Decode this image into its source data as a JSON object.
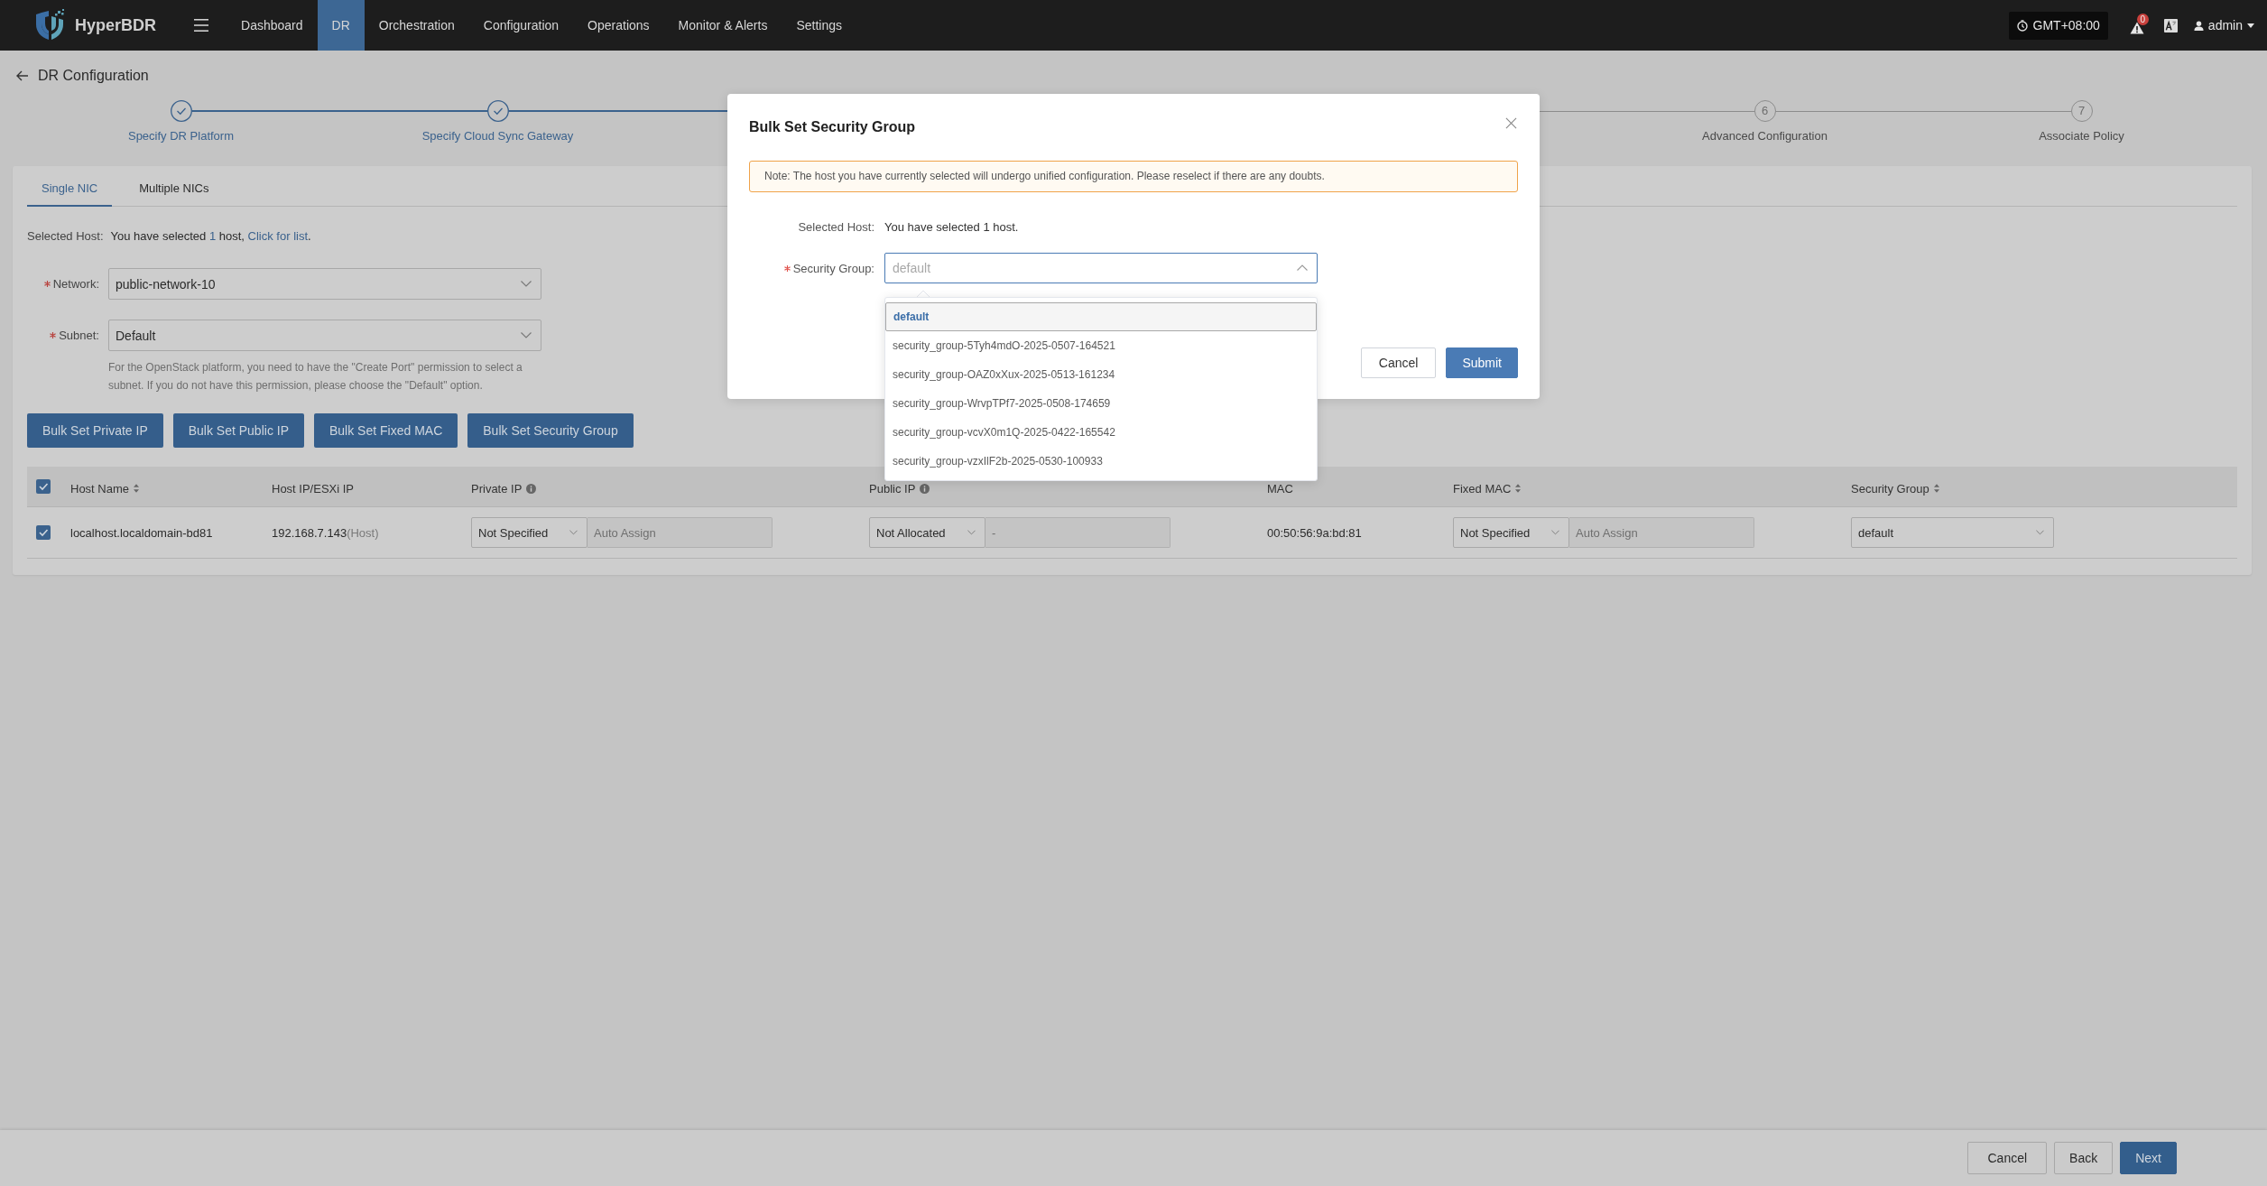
{
  "header": {
    "logo": "HyperBDR",
    "nav": [
      {
        "label": "Dashboard",
        "selected": false
      },
      {
        "label": "DR",
        "selected": true
      },
      {
        "label": "Orchestration",
        "selected": false
      },
      {
        "label": "Configuration",
        "selected": false
      },
      {
        "label": "Operations",
        "selected": false
      },
      {
        "label": "Monitor & Alerts",
        "selected": false
      },
      {
        "label": "Settings",
        "selected": false
      }
    ],
    "timezone": "GMT+08:00",
    "notification_count": "0",
    "user": "admin"
  },
  "page": {
    "title": "DR Configuration"
  },
  "stepper": {
    "steps": [
      {
        "label": "Specify DR Platform",
        "done": true
      },
      {
        "label": "Specify Cloud Sync Gateway",
        "done": true
      },
      {
        "label": "Advanced Configuration",
        "done": false,
        "number": "6"
      },
      {
        "label": "Associate Policy",
        "done": false,
        "number": "7"
      }
    ]
  },
  "card": {
    "tabs": [
      {
        "label": "Single NIC",
        "selected": true
      },
      {
        "label": "Multiple NICs",
        "selected": false
      }
    ],
    "selected_host": {
      "label": "Selected Host:",
      "text_start": "You have selected",
      "count": "1",
      "text_mid": "host,",
      "link": "Click for list",
      "text_end": "."
    },
    "fields": [
      {
        "label": "Network:",
        "required": true,
        "value": "public-network-10"
      },
      {
        "label": "Subnet:",
        "required": true,
        "value": "Default",
        "help": "For the OpenStack platform, you need to have the \"Create Port\" permission to select a subnet. If you do not have this permission, please choose the \"Default\" option."
      }
    ],
    "buttons": [
      "Bulk Set Private IP",
      "Bulk Set Public IP",
      "Bulk Set Fixed MAC",
      "Bulk Set Security Group"
    ],
    "table": {
      "select_all_checked": true,
      "columns": [
        {
          "label": "Host Name",
          "sortable": true,
          "info": false
        },
        {
          "label": "Host IP/ESXi IP",
          "sortable": false,
          "info": false
        },
        {
          "label": "Private IP",
          "sortable": false,
          "info": true
        },
        {
          "label": "Public IP",
          "sortable": false,
          "info": true
        },
        {
          "label": "MAC",
          "sortable": false,
          "info": false
        },
        {
          "label": "Fixed MAC",
          "sortable": true,
          "info": false
        },
        {
          "label": "Security Group",
          "sortable": true,
          "info": false
        }
      ],
      "rows": [
        {
          "checked": true,
          "host_name": "localhost.localdomain-bd81",
          "host_ip": "192.168.7.143",
          "host_ip_note": "(Host)",
          "private_ip": {
            "mode": "Not Specified",
            "placeholder": "Auto Assign",
            "disabled": true
          },
          "public_ip": {
            "mode": "Not Allocated",
            "placeholder": "-",
            "disabled": true
          },
          "mac": "00:50:56:9a:bd:81",
          "fixed_mac": {
            "mode": "Not Specified",
            "placeholder": "Auto Assign",
            "disabled": true
          },
          "security_group": "default"
        }
      ]
    }
  },
  "footer": {
    "buttons": [
      {
        "label": "Cancel",
        "kind": "default"
      },
      {
        "label": "Back",
        "kind": "default"
      },
      {
        "label": "Next",
        "kind": "primary"
      }
    ]
  },
  "modal": {
    "title": "Bulk Set Security Group",
    "note": "Note: The host you have currently selected will undergo unified configuration. Please reselect if there are any doubts.",
    "selected_host": {
      "label": "Selected Host:",
      "text": "You have selected 1 host."
    },
    "security_group": {
      "label": "Security Group:",
      "required": true,
      "placeholder": "default",
      "focused": true,
      "open": true,
      "options": [
        {
          "label": "default",
          "selected": true
        },
        {
          "label": "security_group-5Tyh4mdO-2025-0507-164521",
          "selected": false
        },
        {
          "label": "security_group-OAZ0xXux-2025-0513-161234",
          "selected": false
        },
        {
          "label": "security_group-WrvpTPf7-2025-0508-174659",
          "selected": false
        },
        {
          "label": "security_group-vcvX0m1Q-2025-0422-165542",
          "selected": false
        },
        {
          "label": "security_group-vzxIlF2b-2025-0530-100933",
          "selected": false
        }
      ]
    },
    "buttons": [
      {
        "label": "Cancel",
        "kind": "default"
      },
      {
        "label": "Submit",
        "kind": "primary"
      }
    ]
  }
}
